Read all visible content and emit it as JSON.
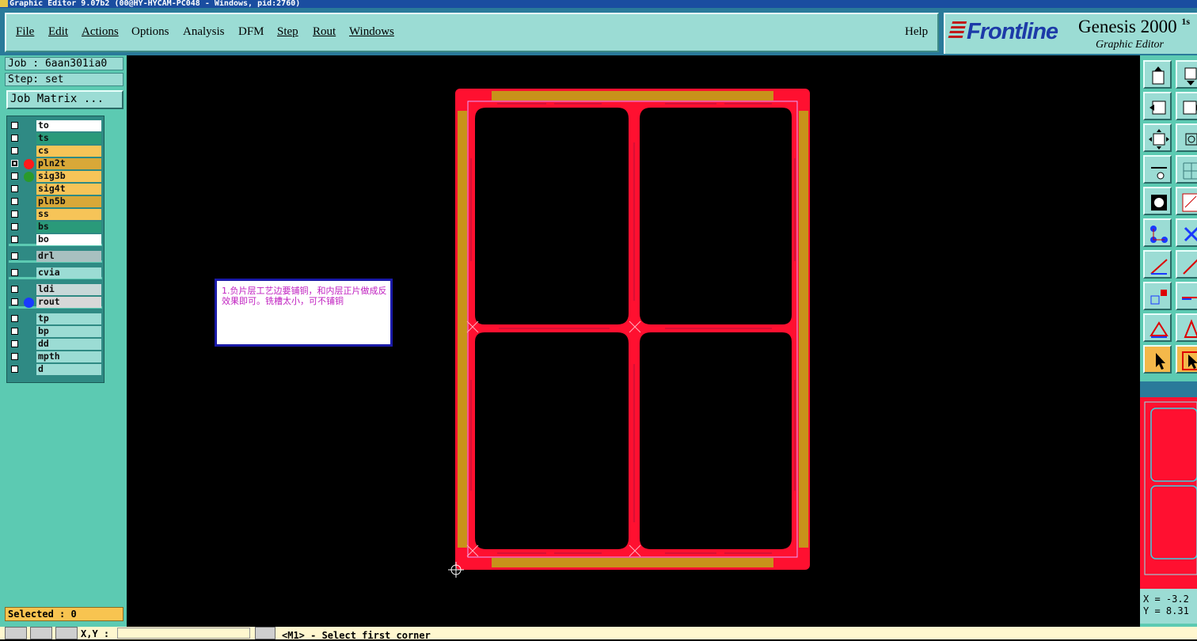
{
  "window": {
    "title": "Graphic Editor 9.07b2 (00@HY-HYCAM-PC048 - Windows, pid:2760)"
  },
  "menu": {
    "items": [
      {
        "label": "File"
      },
      {
        "label": "Edit"
      },
      {
        "label": "Actions"
      },
      {
        "label": "Options"
      },
      {
        "label": "Analysis"
      },
      {
        "label": "DFM"
      },
      {
        "label": "Step"
      },
      {
        "label": "Rout"
      },
      {
        "label": "Windows"
      }
    ],
    "help": "Help"
  },
  "brand": {
    "logo": "Frontline",
    "title": "Genesis 2000",
    "superscript": "1s",
    "subtitle": "Graphic Editor"
  },
  "job": {
    "job_text": "Job : 6aan301ia0",
    "step_text": "Step: set",
    "matrix_button": "Job Matrix ..."
  },
  "layers": [
    {
      "name": "to",
      "color": "#ffffff",
      "checked": false,
      "dot": null
    },
    {
      "name": "ts",
      "color": "#2a9a7a",
      "checked": false,
      "dot": null
    },
    {
      "name": "cs",
      "color": "#f6c458",
      "checked": false,
      "dot": null
    },
    {
      "name": "pln2t",
      "color": "#d8a838",
      "checked": true,
      "dot": "#ff1a1a"
    },
    {
      "name": "sig3b",
      "color": "#f6c458",
      "checked": false,
      "dot": "#2a9a2a"
    },
    {
      "name": "sig4t",
      "color": "#f6c458",
      "checked": false,
      "dot": null
    },
    {
      "name": "pln5b",
      "color": "#d8a838",
      "checked": false,
      "dot": null
    },
    {
      "name": "ss",
      "color": "#f6c458",
      "checked": false,
      "dot": null
    },
    {
      "name": "bs",
      "color": "#2a9a7a",
      "checked": false,
      "dot": null
    },
    {
      "name": "bo",
      "color": "#ffffff",
      "checked": false,
      "dot": null
    },
    {
      "name": "drl",
      "color": "#a8c0c0",
      "checked": false,
      "dot": null
    },
    {
      "name": "cvia",
      "color": "#9bdcd4",
      "checked": false,
      "dot": null
    },
    {
      "name": "ldi",
      "color": "#c8d8d8",
      "checked": false,
      "dot": null
    },
    {
      "name": "rout",
      "color": "#d8d8d8",
      "checked": false,
      "dot": "#1a3aff"
    },
    {
      "name": "tp",
      "color": "#9bdcd4",
      "checked": false,
      "dot": null
    },
    {
      "name": "bp",
      "color": "#9bdcd4",
      "checked": false,
      "dot": null
    },
    {
      "name": "dd",
      "color": "#9bdcd4",
      "checked": false,
      "dot": null
    },
    {
      "name": "mpth",
      "color": "#9bdcd4",
      "checked": false,
      "dot": null
    },
    {
      "name": "d",
      "color": "#9bdcd4",
      "checked": false,
      "dot": null
    }
  ],
  "selected_text": "Selected : 0",
  "note_text": "1.负片层工艺边要铺铜，和内层正片做成反效果即可。铣槽太小，可不铺铜",
  "coords": {
    "x_text": "X = -3.2",
    "y_text": "Y = 8.31"
  },
  "status": {
    "xy_label": "X,Y :",
    "prompt": "<M1> - Select first corner"
  },
  "colors": {
    "board": "#ff1030",
    "frame": "#c8921a",
    "outline": "#e8a0ff",
    "panel": "#5ccab2",
    "menu": "#9bdcd4"
  },
  "icons": [
    "layer-up-icon",
    "layer-down-icon",
    "panel-left-icon",
    "panel-right-icon",
    "zoom-fit-icon",
    "zoom-area-icon",
    "measure-icon",
    "grid-icon",
    "snap-icon",
    "graphic-icon",
    "features-icon",
    "cross-icon",
    "line-icon",
    "line2-icon",
    "pad-icon",
    "dash-icon",
    "triangle-icon",
    "triangle2-icon",
    "select-arrow-icon",
    "select-arrow2-icon"
  ]
}
